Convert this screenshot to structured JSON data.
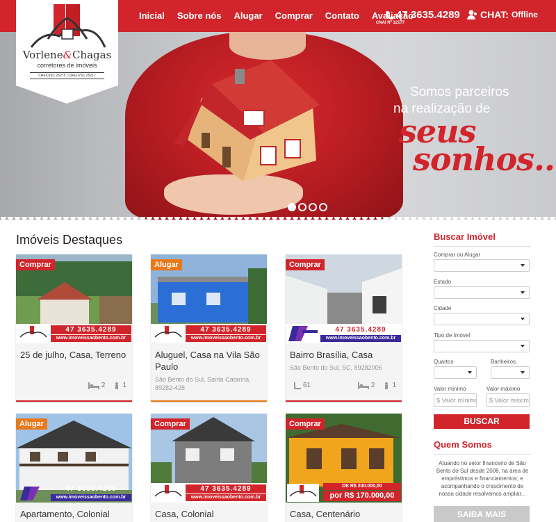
{
  "header": {
    "nav": [
      {
        "label": "Inicial"
      },
      {
        "label": "Sobre nós"
      },
      {
        "label": "Alugar"
      },
      {
        "label": "Comprar"
      },
      {
        "label": "Contato"
      },
      {
        "label": "Avaliação",
        "sub": "CNAI Nº 12177"
      }
    ],
    "phone": "47 3635.4289",
    "chat_label": "CHAT:",
    "chat_status": "Offline"
  },
  "logo": {
    "name_a": "Vorlene",
    "amp": "&",
    "name_b": "Chagas",
    "tagline": "corretores de imóveis",
    "creci": "CRECI/SC 25275 | CRECI/SC 25217"
  },
  "hero": {
    "line1": "Somos parceiros",
    "line2": "na realização de",
    "line3": "seus",
    "line4": "sonhos...",
    "slides": 4,
    "active_slide": 1
  },
  "featured": {
    "title": "Imóveis Destaques",
    "promo_phone": "47 3635.4289",
    "promo_site": "www.imoveissaobento.com.br",
    "cards": [
      {
        "badge": "Comprar",
        "title": "25 de julho, Casa, Terreno",
        "address": "",
        "area": "",
        "beds": "2",
        "baths": "1"
      },
      {
        "badge": "Alugar",
        "title": "Aluguel, Casa na Vila São Paulo",
        "address": "São Bento do Sul, Santa Catarina, 89282-428",
        "area": "",
        "beds": "",
        "baths": ""
      },
      {
        "badge": "Comprar",
        "title": "Bairro Brasília, Casa",
        "address": "São Bento do Sul, SC, 89282006",
        "area": "61",
        "beds": "2",
        "baths": "1"
      },
      {
        "badge": "Alugar",
        "title": "Apartamento, Colonial",
        "address": "",
        "area": "",
        "beds": "",
        "baths": ""
      },
      {
        "badge": "Comprar",
        "title": "Casa, Colonial",
        "address": "",
        "area": "",
        "beds": "",
        "baths": ""
      },
      {
        "badge": "Comprar",
        "title": "Casa, Centenário",
        "address": "",
        "area": "",
        "beds": "",
        "baths": ""
      }
    ],
    "price_old": "DE R$ 200.000,00",
    "price_new": "por R$ 170.000,00"
  },
  "search": {
    "title": "Buscar Imóvel",
    "f1": "Comprar ou Alugar",
    "f2": "Estado",
    "f3": "Cidade",
    "f4": "Tipo de Imóvel",
    "f5": "Quartos",
    "f6": "Banheiros",
    "f7": "Valor mínimo",
    "f8": "Valor máximo",
    "min_placeholder": "$ Valor mínimo",
    "max_placeholder": "$ Valor máximo",
    "button": "BUSCAR"
  },
  "about": {
    "title": "Quem Somos",
    "text": "Atuando no setor financeiro de São Bento do Sul desde 2008, na área de empréstimos e financiamentos; e acompanhando o crescimento de nossa cidade resolvemos ampliar...",
    "button": "SAIBA MAIS"
  },
  "colors": {
    "accent": "#d1252b",
    "rent": "#e8791a"
  }
}
